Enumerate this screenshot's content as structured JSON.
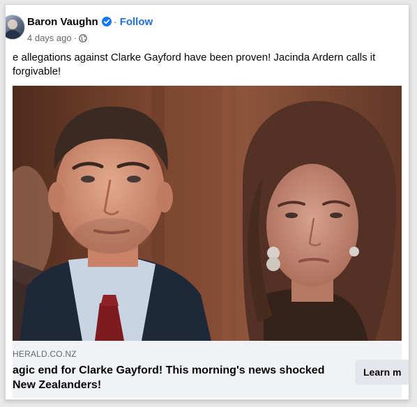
{
  "post": {
    "author": "Baron Vaughn",
    "separator": "·",
    "follow_label": "Follow",
    "timestamp": "4 days ago",
    "meta_separator": "·",
    "text_lines": [
      "e allegations against Clarke Gayford have been proven! Jacinda Ardern calls it",
      "forgivable!"
    ]
  },
  "icons": {
    "verified": "verified-badge-icon",
    "privacy": "globe-icon",
    "avatar": "avatar"
  },
  "link_preview": {
    "domain": "HERALD.CO.NZ",
    "headline_lines": [
      "agic end for Clarke Gayford! This morning's news shocked",
      "New Zealanders!"
    ],
    "cta_label": "Learn m"
  },
  "colors": {
    "link_blue": "#216fdb",
    "text_primary": "#050505",
    "text_secondary": "#65676b",
    "link_bar_bg": "#f0f2f5",
    "button_bg": "#e4e6eb",
    "verified_blue": "#1877f2"
  }
}
